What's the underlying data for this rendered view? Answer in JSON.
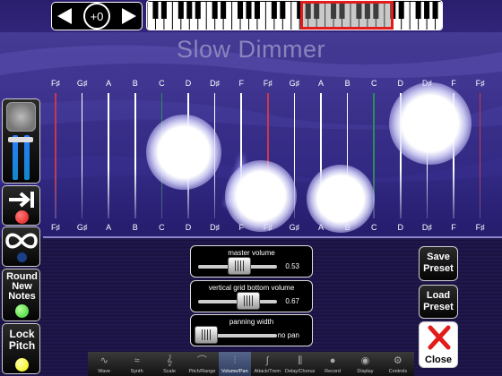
{
  "transpose": {
    "value": "+0"
  },
  "title": "Slow Dimmer",
  "notes_top": [
    "F♯",
    "G♯",
    "A",
    "B",
    "C",
    "D",
    "D♯",
    "F",
    "F♯",
    "G♯",
    "A",
    "B",
    "C",
    "D",
    "D♯",
    "F",
    "F♯"
  ],
  "notes_bottom": [
    "F♯",
    "G♯",
    "A",
    "B",
    "C",
    "D",
    "D♯",
    "F",
    "F♯",
    "G♯",
    "A",
    "B",
    "C",
    "D",
    "D♯",
    "F",
    "F♯"
  ],
  "string_colors": [
    "#c9384a",
    "#ffffff",
    "#ffffff",
    "#ffffff",
    "#2e8d56",
    "#ffffff",
    "#ffffff",
    "#ffffff",
    "#c9384a",
    "#ffffff",
    "#ffffff",
    "#ffffff",
    "#2e8d56",
    "#ffffff",
    "#ffffff",
    "#ffffff",
    "#c9384a"
  ],
  "sidebar": {
    "round_label": "Round New Notes",
    "lock_label": "Lock Pitch",
    "sustain_led": "#e01616",
    "loop_led": "#1a3f86",
    "round_led": "#2fd02b",
    "lock_led": "#f2f200"
  },
  "sliders": [
    {
      "label": "master volume",
      "value": "0.53",
      "level": 0.53
    },
    {
      "label": "vertical grid bottom volume",
      "value": "0.67",
      "level": 0.67
    },
    {
      "label": "panning width",
      "value": "no pan",
      "level": 0.0
    }
  ],
  "buttons": {
    "save_preset": "Save Preset",
    "load_preset": "Load Preset",
    "close": "Close"
  },
  "tabs": [
    {
      "label": "Wave",
      "icon": "wave-icon",
      "active": false
    },
    {
      "label": "Synth",
      "icon": "synth-icon",
      "active": false
    },
    {
      "label": "Scale",
      "icon": "treble-clef-icon",
      "active": false
    },
    {
      "label": "Pitch/Range",
      "icon": "pitch-icon",
      "active": false
    },
    {
      "label": "Volume/Pan",
      "icon": "mixer-icon",
      "active": true
    },
    {
      "label": "Attack/Trem",
      "icon": "attack-icon",
      "active": false
    },
    {
      "label": "Delay/Chorus",
      "icon": "delay-icon",
      "active": false
    },
    {
      "label": "Record",
      "icon": "record-icon",
      "active": false
    },
    {
      "label": "Display",
      "icon": "eye-icon",
      "active": false
    },
    {
      "label": "Controls",
      "icon": "gear-icon",
      "active": false
    }
  ],
  "colors": {
    "accent_red": "#e21b1b",
    "active_tab": "#3d4f77"
  }
}
